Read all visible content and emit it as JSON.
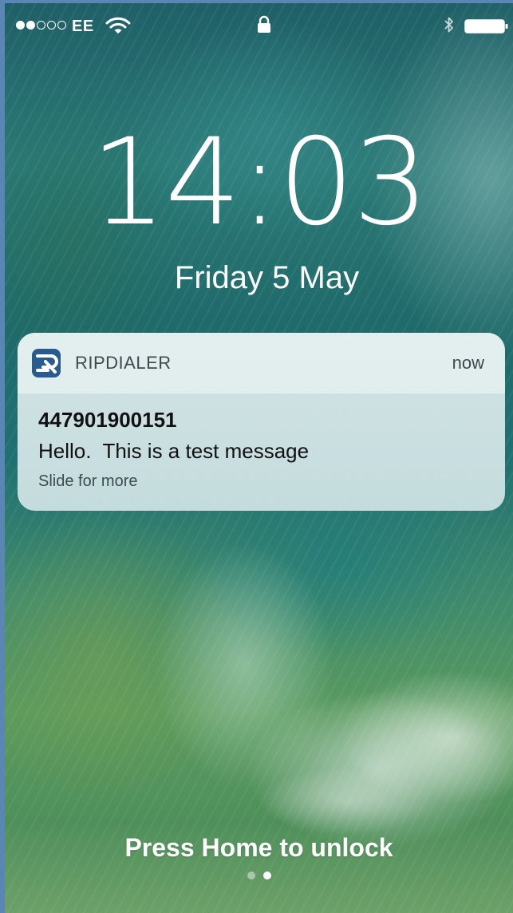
{
  "status_bar": {
    "signal_strength": 2,
    "signal_total": 5,
    "carrier": "EE",
    "icons": [
      "wifi-icon",
      "lock-icon",
      "bluetooth-icon",
      "battery-icon"
    ],
    "battery_level": 1.0
  },
  "lock_screen": {
    "time": "14:03",
    "date": "Friday 5 May"
  },
  "notification": {
    "app_name": "RIPDIALER",
    "time": "now",
    "title": "447901900151",
    "body": "Hello.  This is a test message",
    "hint": "Slide for more",
    "app_icon": "ripdialer-app-icon",
    "app_icon_color": "#2a5b8f"
  },
  "footer": {
    "unlock_text": "Press Home to unlock",
    "pages_total": 2,
    "active_page": 2
  }
}
